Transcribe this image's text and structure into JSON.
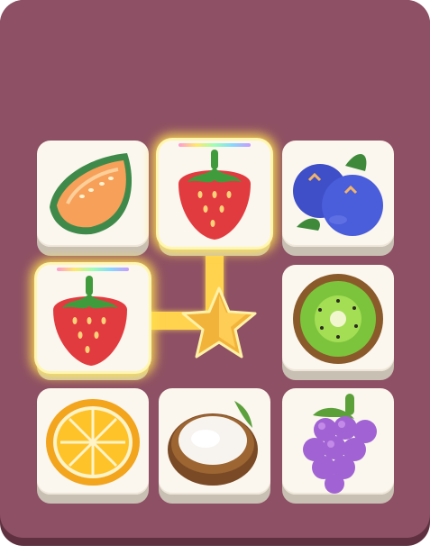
{
  "game": {
    "tiles": [
      {
        "row": 0,
        "col": 0,
        "fruit": "cantaloupe-icon",
        "selected": false
      },
      {
        "row": 0,
        "col": 1,
        "fruit": "strawberry-icon",
        "selected": true
      },
      {
        "row": 0,
        "col": 2,
        "fruit": "blueberry-icon",
        "selected": false
      },
      {
        "row": 1,
        "col": 0,
        "fruit": "strawberry-icon",
        "selected": true
      },
      {
        "row": 1,
        "col": 2,
        "fruit": "kiwi-icon",
        "selected": false
      },
      {
        "row": 2,
        "col": 0,
        "fruit": "orange-slice-icon",
        "selected": false
      },
      {
        "row": 2,
        "col": 1,
        "fruit": "coconut-icon",
        "selected": false
      },
      {
        "row": 2,
        "col": 2,
        "fruit": "grapes-icon",
        "selected": false
      }
    ],
    "match_marker": "star-icon",
    "colors": {
      "board": "#8e5064",
      "board_shadow": "#5f3140",
      "tile_face": "#fbf7ee",
      "highlight": "#ffd34d"
    }
  }
}
